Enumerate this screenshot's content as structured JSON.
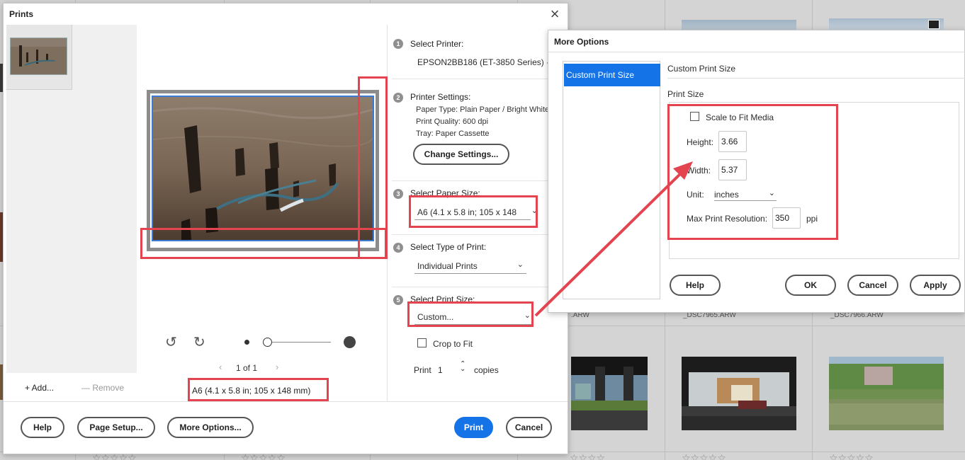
{
  "background": {
    "filenames": [
      "_DSC7965.ARW",
      "_DSC7966.ARW",
      ".ARW"
    ]
  },
  "prints": {
    "title": "Prints",
    "add_label": "+ Add...",
    "remove_label": "— Remove",
    "pager": {
      "text": "1 of 1"
    },
    "paper_size_label": "A6 (4.1 x 5.8 in; 105 x 148 mm)",
    "steps": {
      "printer": {
        "num": "1",
        "label": "Select Printer:",
        "value": "EPSON2BB186 (ET-3850 Series)"
      },
      "settings": {
        "num": "2",
        "label": "Printer Settings:",
        "paper_type": "Paper Type: Plain Paper / Bright White",
        "quality": "Print Quality: 600 dpi",
        "tray": "Tray: Paper Cassette",
        "button": "Change Settings..."
      },
      "paper": {
        "num": "3",
        "label": "Select Paper Size:",
        "value": "A6 (4.1 x 5.8 in; 105 x 148"
      },
      "type": {
        "num": "4",
        "label": "Select Type of Print:",
        "value": "Individual Prints"
      },
      "size": {
        "num": "5",
        "label": "Select Print Size:",
        "value": "Custom..."
      }
    },
    "crop_label": "Crop to Fit",
    "print_label": "Print",
    "copies_value": "1",
    "copies_label": "copies",
    "buttons": {
      "help": "Help",
      "page_setup": "Page Setup...",
      "more_options": "More Options...",
      "print": "Print",
      "cancel": "Cancel"
    }
  },
  "more_options": {
    "title": "More Options",
    "nav_item": "Custom Print Size",
    "section_title": "Custom Print Size",
    "print_size_label": "Print Size",
    "scale_label": "Scale to Fit Media",
    "height_label": "Height:",
    "height_value": "3.66",
    "width_label": "Width:",
    "width_value": "5.37",
    "unit_label": "Unit:",
    "unit_value": "inches",
    "resolution_label": "Max Print Resolution:",
    "resolution_value": "350",
    "resolution_unit": "ppi",
    "buttons": {
      "help": "Help",
      "ok": "OK",
      "cancel": "Cancel",
      "apply": "Apply"
    }
  },
  "colors": {
    "accent": "#1473e6",
    "annotation": "#e3444f"
  }
}
